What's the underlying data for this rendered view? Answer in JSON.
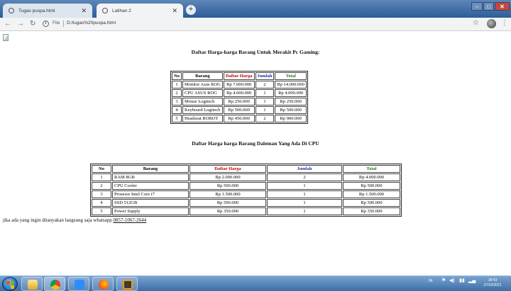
{
  "browser": {
    "tabs": [
      {
        "title": "Tugas puspa.html",
        "active": false
      },
      {
        "title": "Latihan 2",
        "active": true
      }
    ],
    "file_label": "File",
    "url": "D:/tugas%20puspa.html"
  },
  "page": {
    "heading1": "Daftar Harga-harga Barang Untuk Merakit Pc Gaming:",
    "table1": {
      "headers": [
        "No",
        "Barang",
        "Daftar Harga",
        "Jumlah",
        "Total"
      ],
      "rows": [
        [
          "1",
          "Monitor Asus ROG",
          "Rp 7.000.000",
          "2",
          "Rp 14.000.000"
        ],
        [
          "2",
          "CPU ASUS ROG",
          "Rp 4.000.000",
          "1",
          "Rp 4.000.000"
        ],
        [
          "3",
          "Mouse Logitech",
          "Rp 250.000",
          "1",
          "Rp 250.000"
        ],
        [
          "4",
          "Keyboard Logitech",
          "Rp 500.000",
          "1",
          "Rp 500.000"
        ],
        [
          "5",
          "Headseat ROBOT",
          "Rp 450.000",
          "2",
          "Rp 900.000"
        ]
      ]
    },
    "heading2": "Daftar Harga harga Barang Daleman Yang Ada Di CPU",
    "table2": {
      "headers": [
        "No",
        "Barang",
        "Daftar Harga",
        "Jumlah",
        "Total"
      ],
      "rows": [
        [
          "1",
          "RAM 8GB",
          "Rp 2.000.000",
          "2",
          "Rp 4.000.000"
        ],
        [
          "2",
          "CPU Cooler",
          "Rp 500.000",
          "1",
          "Rp 500.000"
        ],
        [
          "3",
          "Prosesor Intel Core i7",
          "Rp 1.500.000",
          "1",
          "Rp 1.500.000"
        ],
        [
          "4",
          "SSD 512GB",
          "Rp 500.000",
          "1",
          "Rp 500.000"
        ],
        [
          "5",
          "Power Supply",
          "Rp 350.000",
          "1",
          "Rp 350.000"
        ]
      ]
    },
    "footer": {
      "text": "jika ada yang ingin ditanyakan langsung saja whatsapp ",
      "phone": "0857-1067-2644"
    }
  },
  "taskbar": {
    "language": "IN",
    "time": "18:43",
    "date": "27/10/2021",
    "apps": [
      "explorer",
      "chrome",
      "zoom",
      "firefox",
      "sublime"
    ]
  },
  "colors": {
    "header_red": "#c00000",
    "header_blue": "#1a2fa0",
    "header_green": "#1e7a1e"
  }
}
